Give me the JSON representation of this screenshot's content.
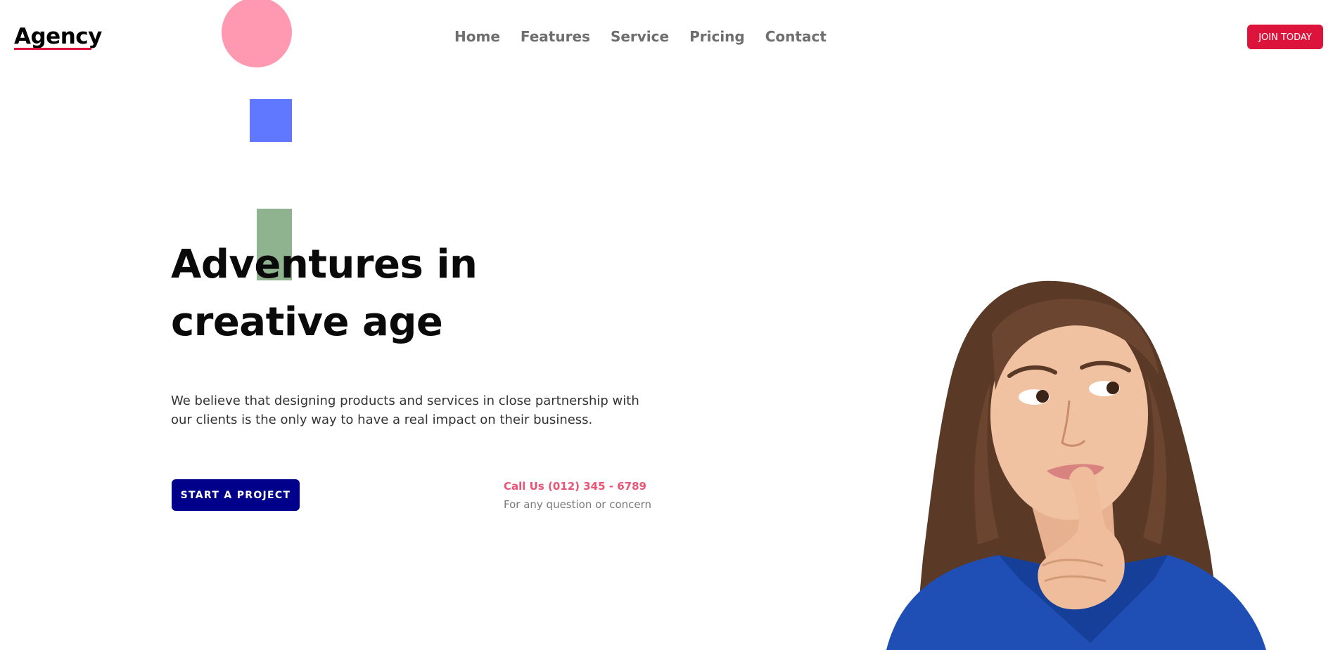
{
  "header": {
    "logo": "Agency",
    "nav": [
      "Home",
      "Features",
      "Service",
      "Pricing",
      "Contact"
    ],
    "cta_label": "JOIN TODAY"
  },
  "hero": {
    "title": "Adventures in creative age",
    "description": "We believe that designing products and services in close partnership with our clients is the only way to have a real impact on their business.",
    "primary_button": "START A PROJECT",
    "call_label": "Call Us (012) 345 - 6789",
    "call_sub": "For any question or concern"
  },
  "colors": {
    "accent": "#dc143c",
    "primary_button": "#00008b",
    "call_text": "#e95475",
    "circle": "#ff99b1",
    "square": "#6078ff",
    "rect": "#8fb38f"
  },
  "icons": {
    "hero_image": "woman-thinking-illustration"
  }
}
